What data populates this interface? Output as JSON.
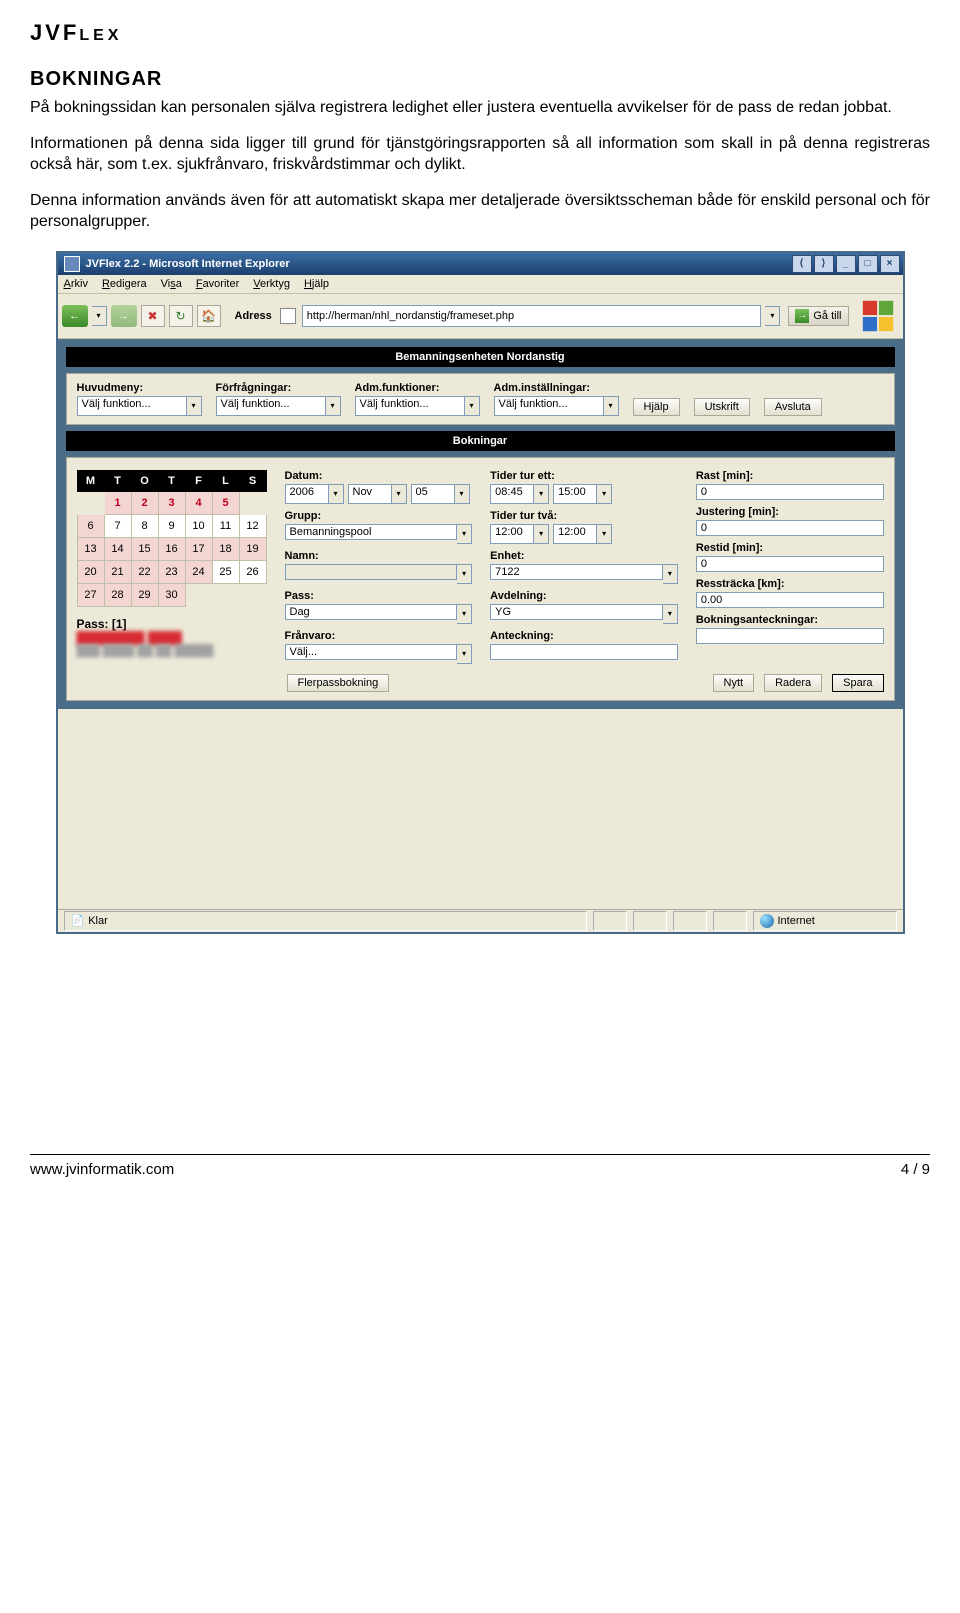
{
  "brand": {
    "jvf": "JVF",
    "lex": "LEX"
  },
  "heading": "BOKNINGAR",
  "para1": "På bokningssidan kan personalen själva registrera ledighet eller justera eventuella avvikelser för de pass de redan jobbat.",
  "para2": "Informationen på denna sida ligger till grund för tjänstgöringsrapporten så all information som skall in på denna registreras också här, som t.ex. sjukfrånvaro, friskvårdstimmar och dylikt.",
  "para3": "Denna information används även för att automatiskt skapa mer detaljerade översiktsscheman både för enskild personal och för personalgrupper.",
  "titlebar": "JVFlex 2.2 - Microsoft Internet Explorer",
  "menubar": {
    "arkiv": "Arkiv",
    "redigera": "Redigera",
    "visa": "Visa",
    "favoriter": "Favoriter",
    "verktyg": "Verktyg",
    "hjalp": "Hjälp"
  },
  "address_label": "Adress",
  "address_value": "http://herman/nhl_nordanstig/frameset.php",
  "go_label": "Gå till",
  "header1": "Bemanningsenheten Nordanstig",
  "topselects": {
    "huvudmeny": {
      "label": "Huvudmeny:",
      "value": "Välj funktion..."
    },
    "forfragningar": {
      "label": "Förfrågningar:",
      "value": "Välj funktion..."
    },
    "admfunk": {
      "label": "Adm.funktioner:",
      "value": "Välj funktion..."
    },
    "adminst": {
      "label": "Adm.inställningar:",
      "value": "Välj funktion..."
    }
  },
  "topbuttons": {
    "hjalp": "Hjälp",
    "utskrift": "Utskrift",
    "avsluta": "Avsluta"
  },
  "header2": "Bokningar",
  "calendar": {
    "days": [
      "M",
      "T",
      "O",
      "T",
      "F",
      "L",
      "S"
    ],
    "rows": [
      [
        "",
        "1",
        "2",
        "3",
        "4",
        "5",
        ""
      ],
      [
        "6",
        "7",
        "8",
        "9",
        "10",
        "11",
        "12"
      ],
      [
        "13",
        "14",
        "15",
        "16",
        "17",
        "18",
        "19"
      ],
      [
        "20",
        "21",
        "22",
        "23",
        "24",
        "25",
        "26"
      ],
      [
        "27",
        "28",
        "29",
        "30",
        "",
        "",
        ""
      ]
    ],
    "pass_label": "Pass: [1]"
  },
  "col1": {
    "datum_label": "Datum:",
    "datum_y": "2006",
    "datum_m": "Nov",
    "datum_d": "05",
    "grupp_label": "Grupp:",
    "grupp_val": "Bemanningspool",
    "namn_label": "Namn:",
    "namn_val": "",
    "pass_label": "Pass:",
    "pass_val": "Dag",
    "franvaro_label": "Frånvaro:",
    "franvaro_val": "Välj..."
  },
  "col2": {
    "tider1_label": "Tider tur ett:",
    "tider1_a": "08:45",
    "tider1_b": "15:00",
    "tider2_label": "Tider tur två:",
    "tider2_a": "12:00",
    "tider2_b": "12:00",
    "enhet_label": "Enhet:",
    "enhet_val": "7122",
    "avd_label": "Avdelning:",
    "avd_val": "YG",
    "ant_label": "Anteckning:",
    "ant_val": ""
  },
  "col3": {
    "rast_label": "Rast [min]:",
    "rast_val": "0",
    "just_label": "Justering [min]:",
    "just_val": "0",
    "restid_label": "Restid [min]:",
    "restid_val": "0",
    "ress_label": "Ressträcka [km]:",
    "ress_val": "0.00",
    "bokant_label": "Bokningsanteckningar:",
    "bokant_val": ""
  },
  "buttons": {
    "fler": "Flerpassbokning",
    "nytt": "Nytt",
    "radera": "Radera",
    "spara": "Spara"
  },
  "status": {
    "klar": "Klar",
    "internet": "Internet"
  },
  "footer": {
    "url": "www.jvinformatik.com",
    "page": "4 / 9"
  }
}
